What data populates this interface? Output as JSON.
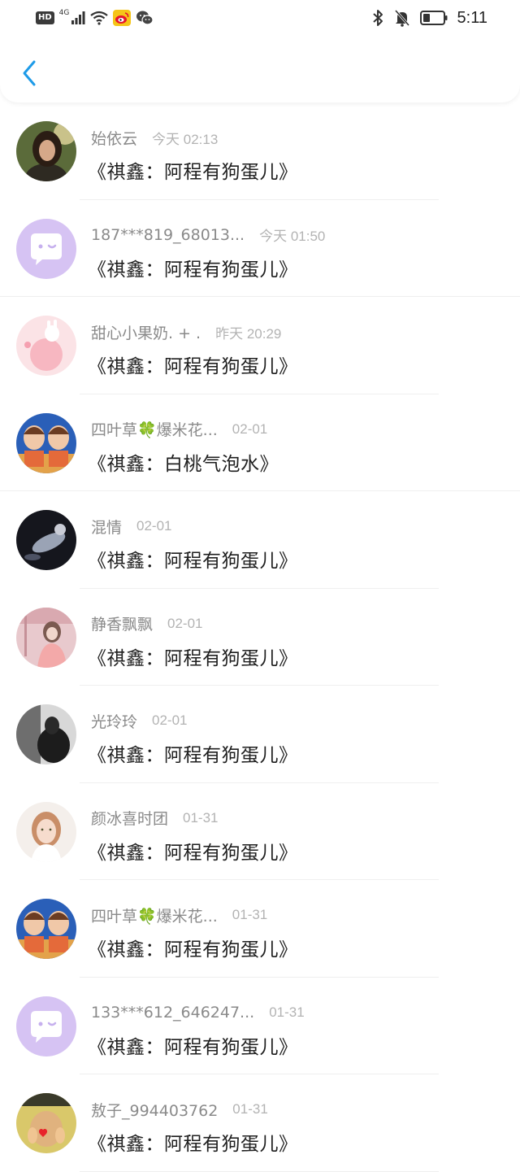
{
  "status_bar": {
    "hd_label": "HD",
    "network_label": "4G",
    "time": "5:11"
  },
  "items": [
    {
      "name": "始依云",
      "date": "今天 02:13",
      "title": "《祺鑫：阿程有狗蛋儿》",
      "avatar": "photo-woman-dark"
    },
    {
      "name": "187***819_68013...",
      "date": "今天 01:50",
      "title": "《祺鑫：阿程有狗蛋儿》",
      "avatar": "default-purple"
    },
    {
      "name": "甜心小果奶. + .",
      "date": "昨天 20:29",
      "title": "《祺鑫：阿程有狗蛋儿》",
      "avatar": "pink-bunny"
    },
    {
      "name": "四叶草🍀爆米花...",
      "date": "02-01",
      "title": "《祺鑫：白桃气泡水》",
      "avatar": "two-boys"
    },
    {
      "name": "混情",
      "date": "02-01",
      "title": "《祺鑫：阿程有狗蛋儿》",
      "avatar": "dark-figure"
    },
    {
      "name": "静香飘飘",
      "date": "02-01",
      "title": "《祺鑫：阿程有狗蛋儿》",
      "avatar": "pink-girl"
    },
    {
      "name": "光玲玲",
      "date": "02-01",
      "title": "《祺鑫：阿程有狗蛋儿》",
      "avatar": "bw-figure"
    },
    {
      "name": "颜冰喜时团",
      "date": "01-31",
      "title": "《祺鑫：阿程有狗蛋儿》",
      "avatar": "light-girl"
    },
    {
      "name": "四叶草🍀爆米花...",
      "date": "01-31",
      "title": "《祺鑫：阿程有狗蛋儿》",
      "avatar": "two-boys"
    },
    {
      "name": "133***612_646247...",
      "date": "01-31",
      "title": "《祺鑫：阿程有狗蛋儿》",
      "avatar": "default-purple"
    },
    {
      "name": "敖子_994403762",
      "date": "01-31",
      "title": "《祺鑫：阿程有狗蛋儿》",
      "avatar": "yellow-heart"
    }
  ],
  "colors": {
    "accent": "#1e9be8",
    "name_text": "#8a8a8a",
    "date_text": "#b3b3b3",
    "title_text": "#1f1f1f",
    "default_avatar": "#d6c3f3"
  }
}
